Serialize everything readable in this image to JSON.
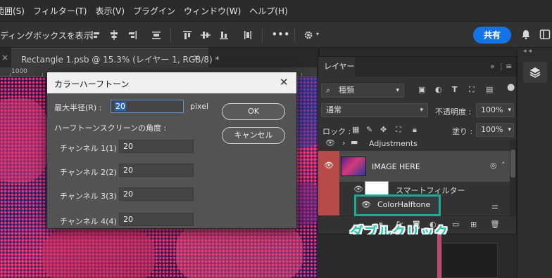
{
  "menu": {
    "items": [
      "範囲(S)",
      "フィルター(T)",
      "表示(V)",
      "プラグイン",
      "ウィンドウ(W)",
      "ヘルプ(H)"
    ]
  },
  "options_bar": {
    "label": "ディングボックスを表示",
    "more": "•••",
    "share_label": "共有"
  },
  "document": {
    "tab_title": "Rectangle 1.psb @ 15.3% (レイヤー 1, RGB/8) *",
    "close_glyph": "×",
    "ruler_label": "1000"
  },
  "dialog": {
    "title": "カラーハーフトーン",
    "close_glyph": "✕",
    "max_radius_label": "最大半径(R) :",
    "max_radius_value": "20",
    "max_radius_unit": "pixel",
    "angle_heading": "ハーフトーンスクリーンの角度 :",
    "channels": [
      {
        "label": "チャンネル 1(1) :",
        "value": "20"
      },
      {
        "label": "チャンネル 2(2) :",
        "value": "20"
      },
      {
        "label": "チャンネル 3(3) :",
        "value": "20"
      },
      {
        "label": "チャンネル 4(4) :",
        "value": "20"
      }
    ],
    "ok_label": "OK",
    "cancel_label": "キャンセル"
  },
  "layers_panel": {
    "tab_label": "レイヤー",
    "collapse_glyph": "»",
    "menu_glyph": "≡",
    "filter_kind": "種類",
    "blend_mode": "通常",
    "opacity_label": "不透明度 :",
    "opacity_value": "100%",
    "lock_label": "ロック :",
    "fill_label": "塗り :",
    "fill_value": "100%",
    "layers": [
      {
        "name": "Adjustments",
        "type": "group"
      },
      {
        "name": "IMAGE HERE",
        "type": "smart-object",
        "selected": true
      },
      {
        "name": "スマートフィルター",
        "type": "smart-filter"
      },
      {
        "name": "ColorHalftone",
        "type": "filter"
      }
    ]
  },
  "annotation": {
    "text": "ダブルクリック",
    "color": "#2fc4b2"
  },
  "colors": {
    "accent_blue": "#1473e6",
    "selected_layer": "#b84a4a",
    "highlight_teal": "#20a99a"
  }
}
